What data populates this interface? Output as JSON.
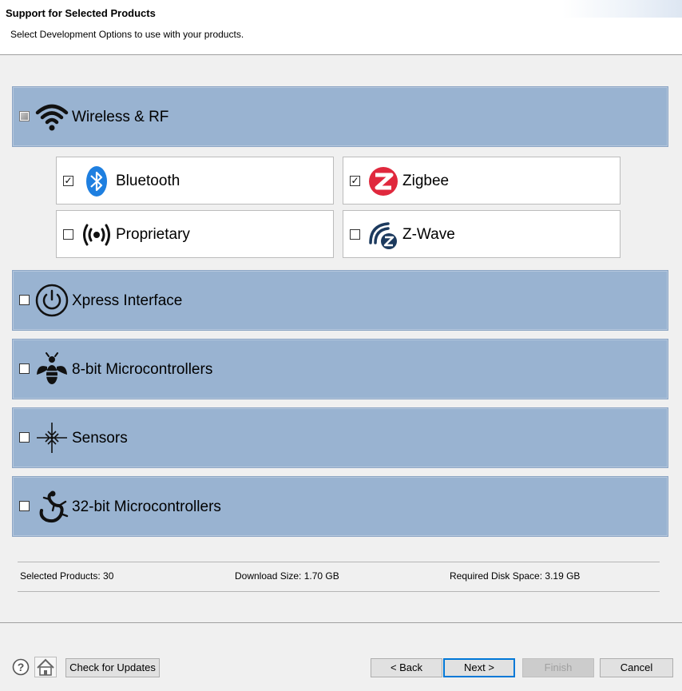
{
  "header": {
    "title": "Support for Selected Products",
    "subtitle": "Select Development Options to use with your products."
  },
  "categories": [
    {
      "label": "Wireless & RF",
      "state": "mixed",
      "icon": "wifi-icon"
    },
    {
      "label": "Xpress Interface",
      "state": "unchecked",
      "icon": "power-icon"
    },
    {
      "label": "8-bit Microcontrollers",
      "state": "unchecked",
      "icon": "bee-icon"
    },
    {
      "label": "Sensors",
      "state": "unchecked",
      "icon": "sensor-arrows-icon"
    },
    {
      "label": "32-bit Microcontrollers",
      "state": "unchecked",
      "icon": "lizard-icon"
    }
  ],
  "wireless_options": [
    {
      "label": "Bluetooth",
      "checked": true,
      "icon": "bluetooth-icon"
    },
    {
      "label": "Zigbee",
      "checked": true,
      "icon": "zigbee-icon"
    },
    {
      "label": "Proprietary",
      "checked": false,
      "icon": "broadcast-icon"
    },
    {
      "label": "Z-Wave",
      "checked": false,
      "icon": "zwave-icon"
    }
  ],
  "stats": {
    "selected_products": "Selected Products:  30",
    "download_size": "Download Size:  1.70 GB",
    "disk_space": "Required Disk Space:  3.19 GB"
  },
  "footer": {
    "check_updates": "Check for Updates",
    "back": "< Back",
    "next": "Next >",
    "finish": "Finish",
    "cancel": "Cancel"
  },
  "colors": {
    "category_bg": "#99b3d1",
    "bluetooth": "#1e7fe0",
    "zigbee": "#e0283d",
    "zwave": "#1c3a5e",
    "default_button_border": "#0078d7"
  }
}
